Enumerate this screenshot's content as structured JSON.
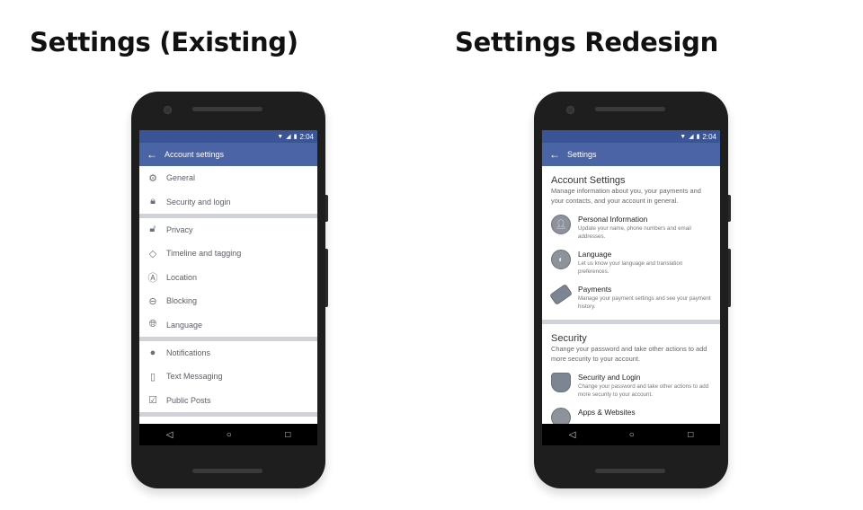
{
  "headings": {
    "left": "Settings (Existing)",
    "right": "Settings Redesign"
  },
  "status_bar": {
    "time": "2:04",
    "icons": [
      "wifi-icon",
      "signal-icon",
      "battery-icon"
    ]
  },
  "existing": {
    "appbar_title": "Account settings",
    "groups": [
      [
        {
          "icon": "gear-icon",
          "label": "General"
        },
        {
          "icon": "lock-icon",
          "label": "Security and login"
        }
      ],
      [
        {
          "icon": "privacy-lock-icon",
          "label": "Privacy"
        },
        {
          "icon": "tag-icon",
          "label": "Timeline and tagging"
        },
        {
          "icon": "location-icon",
          "label": "Location"
        },
        {
          "icon": "block-icon",
          "label": "Blocking"
        },
        {
          "icon": "globe-icon",
          "label": "Language"
        }
      ],
      [
        {
          "icon": "globe-filled-icon",
          "label": "Notifications"
        },
        {
          "icon": "phone-icon",
          "label": "Text Messaging"
        },
        {
          "icon": "public-posts-icon",
          "label": "Public Posts"
        }
      ]
    ]
  },
  "redesign": {
    "appbar_title": "Settings",
    "sections": [
      {
        "title": "Account Settings",
        "description": "Manage information about you, your payments and your contacts, and your account in general.",
        "items": [
          {
            "icon": "person-icon",
            "title": "Personal Information",
            "description": "Update your name, phone numbers and email addresses."
          },
          {
            "icon": "globe-icon",
            "title": "Language",
            "description": "Let us know your language and translation preferences."
          },
          {
            "icon": "credit-card-icon",
            "title": "Payments",
            "description": "Manage your payment settings and see your payment history."
          }
        ]
      },
      {
        "title": "Security",
        "description": "Change your password and take other actions to add more security to your account.",
        "items": [
          {
            "icon": "shield-icon",
            "title": "Security and Login",
            "description": "Change your password and take other actions to add more security to your account."
          },
          {
            "icon": "apps-icon",
            "title": "Apps & Websites",
            "description": ""
          }
        ]
      }
    ]
  },
  "nav": {
    "back": "◁",
    "home": "○",
    "recents": "□"
  },
  "colors": {
    "statusbar": "#3b5495",
    "appbar": "#4a64a6",
    "separator": "#cfd3d8"
  }
}
